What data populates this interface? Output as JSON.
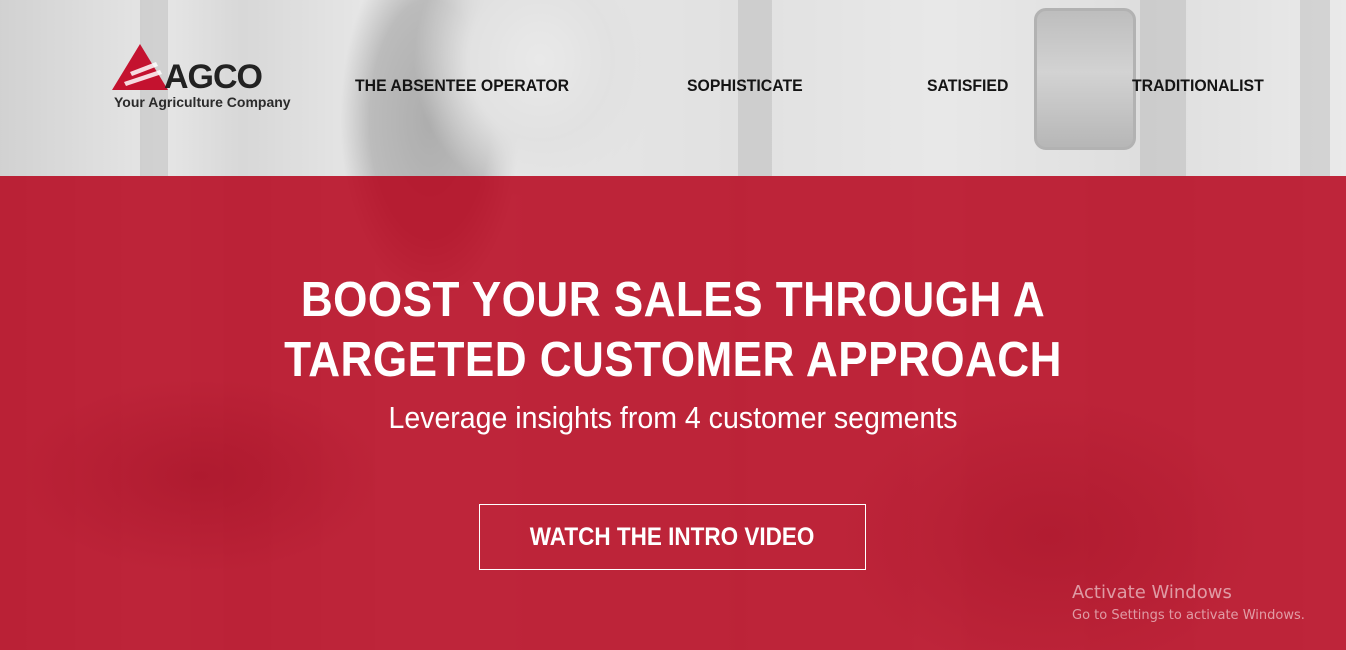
{
  "brand": {
    "name": "AGCO",
    "tagline": "Your Agriculture Company",
    "logo_color": "#c4122f"
  },
  "nav": {
    "items": [
      {
        "label": "THE ABSENTEE OPERATOR"
      },
      {
        "label": "SOPHISTICATE"
      },
      {
        "label": "SATISFIED"
      },
      {
        "label": "TRADITIONALIST"
      }
    ]
  },
  "hero": {
    "title_line1": "BOOST YOUR SALES THROUGH A",
    "title_line2": "TARGETED CUSTOMER APPROACH",
    "subtitle": "Leverage insights from 4 customer segments",
    "cta_label": "WATCH THE INTRO VIDEO",
    "overlay_color": "#bc182e"
  },
  "watermark": {
    "title": "Activate Windows",
    "subtitle": "Go to Settings to activate Windows."
  }
}
